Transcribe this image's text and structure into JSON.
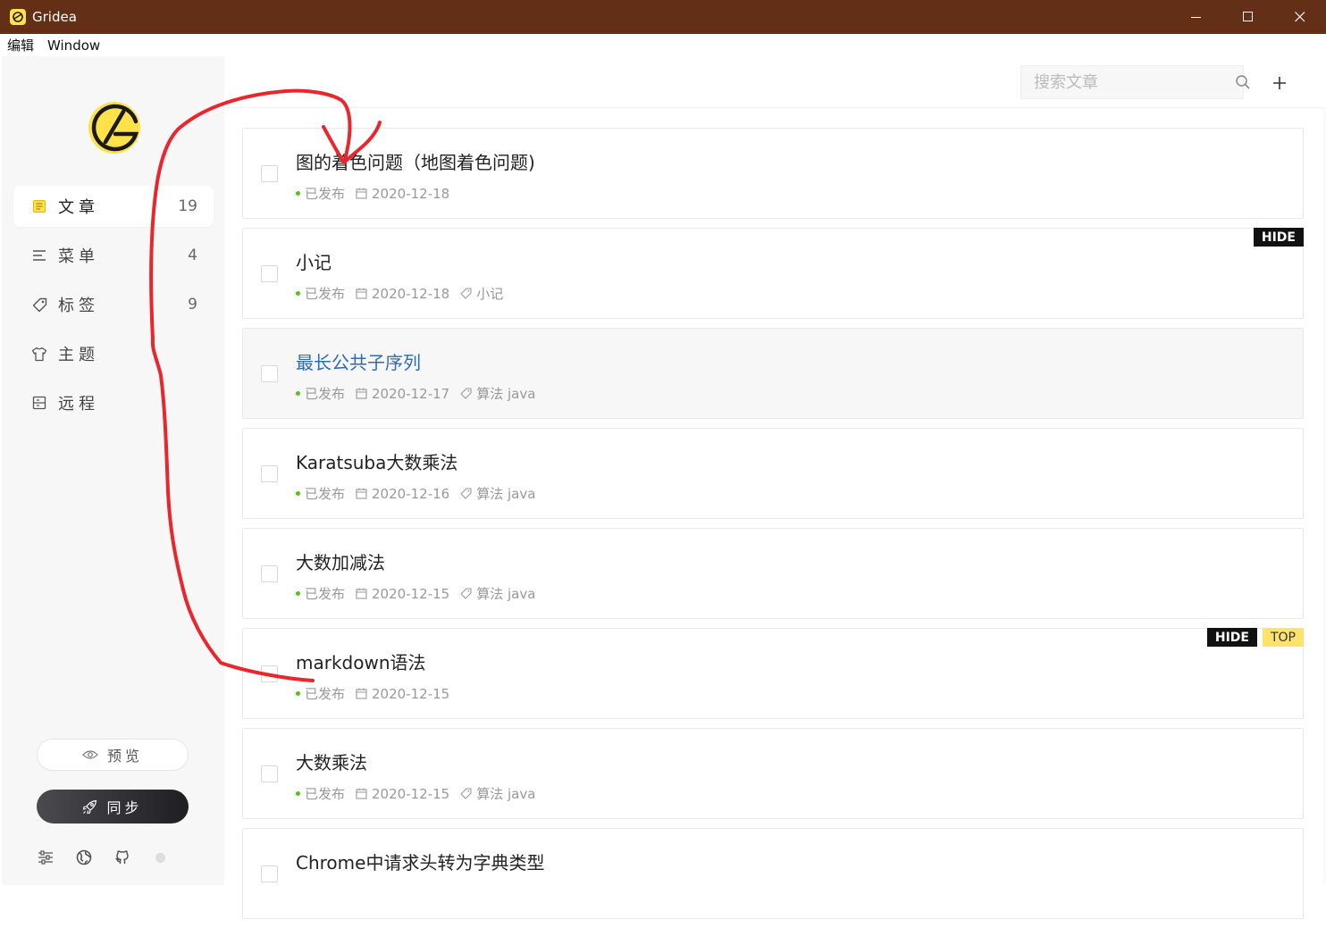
{
  "window": {
    "title": "Gridea"
  },
  "menubar": {
    "items": [
      "编辑",
      "Window"
    ]
  },
  "sidebar": {
    "nav": [
      {
        "label": "文章",
        "count": "19",
        "icon": "article-icon",
        "active": true
      },
      {
        "label": "菜单",
        "count": "4",
        "icon": "menu-icon",
        "active": false
      },
      {
        "label": "标签",
        "count": "9",
        "icon": "tag-icon",
        "active": false
      },
      {
        "label": "主题",
        "count": "",
        "icon": "shirt-icon",
        "active": false
      },
      {
        "label": "远程",
        "count": "",
        "icon": "remote-icon",
        "active": false
      }
    ],
    "preview_label": "预览",
    "sync_label": "同步"
  },
  "search": {
    "placeholder": "搜索文章"
  },
  "posts": [
    {
      "title": "图的着色问题（地图着色问题)",
      "status": "已发布",
      "date": "2020-12-18",
      "tags": "",
      "badges": []
    },
    {
      "title": "小记",
      "status": "已发布",
      "date": "2020-12-18",
      "tags": "小记",
      "badges": [
        "HIDE"
      ]
    },
    {
      "title": "最长公共子序列",
      "status": "已发布",
      "date": "2020-12-17",
      "tags": "算法 java",
      "badges": []
    },
    {
      "title": "Karatsuba大数乘法",
      "status": "已发布",
      "date": "2020-12-16",
      "tags": "算法 java",
      "badges": []
    },
    {
      "title": "大数加减法",
      "status": "已发布",
      "date": "2020-12-15",
      "tags": "算法 java",
      "badges": []
    },
    {
      "title": "markdown语法",
      "status": "已发布",
      "date": "2020-12-15",
      "tags": "",
      "badges": [
        "HIDE",
        "TOP"
      ]
    },
    {
      "title": "大数乘法",
      "status": "已发布",
      "date": "2020-12-15",
      "tags": "算法 java",
      "badges": []
    },
    {
      "title": "Chrome中请求头转为字典类型",
      "status": "",
      "date": "",
      "tags": "",
      "badges": []
    }
  ],
  "colors": {
    "titlebar": "#632f16",
    "accent": "#ffe24a",
    "published": "#52c41a",
    "annotation": "#e8262c"
  }
}
